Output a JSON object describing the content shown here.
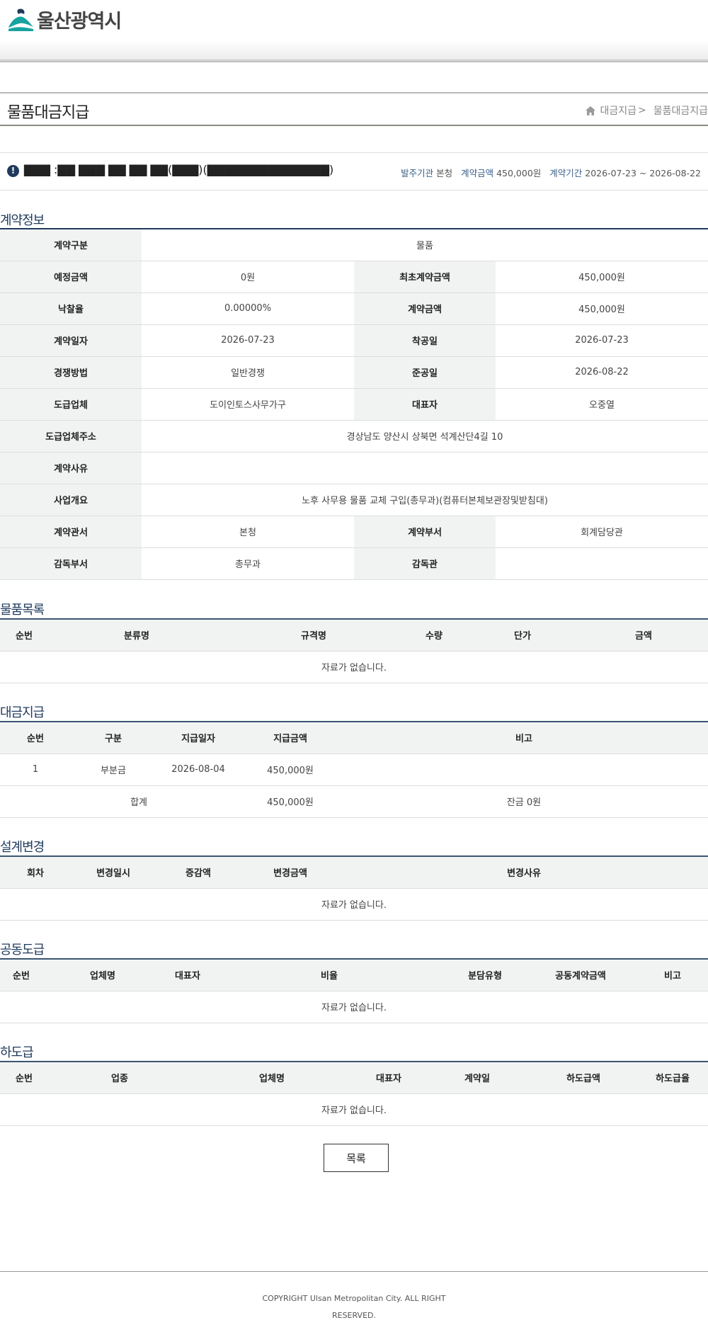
{
  "header": {
    "logo_text": "울산광역시",
    "colors": {
      "logo_teal": "#16a3a0",
      "logo_navy": "#1f3a5c"
    }
  },
  "page": {
    "title": "물품대금지급",
    "breadcrumb": {
      "home_icon": "home-icon",
      "parent": "대금지급",
      "separator": ">",
      "current": "물품대금지급"
    }
  },
  "contract_header": {
    "redacted_name": "▇▇▇ :▇▇ ▇▇▇ ▇▇ ▇▇ ▇▇(▇▇▇)(▇▇▇▇▇▇▇▇▇▇▇▇▇▇)",
    "order_org_label": "발주기관",
    "order_org": "본청",
    "amount_label": "계약금액",
    "amount": "450,000원",
    "period_label": "계약기간",
    "period": "2026-07-23 ~ 2026-08-22"
  },
  "contract_info": {
    "title": "계약정보",
    "rows": [
      {
        "l1": "계약구분",
        "v1": "물품",
        "full": true
      },
      {
        "l1": "예정금액",
        "v1": "0원",
        "l2": "최초계약금액",
        "v2": "450,000원"
      },
      {
        "l1": "낙찰율",
        "v1": "0.00000%",
        "l2": "계약금액",
        "v2": "450,000원"
      },
      {
        "l1": "계약일자",
        "v1": "2026-07-23",
        "l2": "착공일",
        "v2": "2026-07-23"
      },
      {
        "l1": "경쟁방법",
        "v1": "일반경쟁",
        "l2": "준공일",
        "v2": "2026-08-22"
      },
      {
        "l1": "도급업체",
        "v1": "도이인토스사무가구",
        "l2": "대표자",
        "v2": "오중열"
      },
      {
        "l1": "도급업체주소",
        "v1": "경상남도 양산시 상북면 석계산단4길 10",
        "full": true
      },
      {
        "l1": "계약사유",
        "v1": "",
        "full": true
      },
      {
        "l1": "사업개요",
        "v1": "노후 사무용 물품 교체 구입(총무과)(컴퓨터본체보관장및받침대)",
        "full": true
      },
      {
        "l1": "계약관서",
        "v1": "본청",
        "l2": "계약부서",
        "v2": "회계담당관"
      },
      {
        "l1": "감독부서",
        "v1": "총무과",
        "l2": "감독관",
        "v2": ""
      }
    ]
  },
  "goods": {
    "title": "물품목록",
    "headers": [
      "순번",
      "분류명",
      "규격명",
      "수량",
      "단가",
      "금액"
    ],
    "empty": "자료가 없습니다."
  },
  "payment": {
    "title": "대금지급",
    "headers": [
      "순번",
      "구분",
      "지급일자",
      "지급금액",
      "비고"
    ],
    "rows": [
      [
        "1",
        "부분금",
        "2026-08-04",
        "450,000원",
        ""
      ]
    ],
    "total_label": "합계",
    "total_amount": "450,000원",
    "balance": "잔금 0원"
  },
  "design_change": {
    "title": "설계변경",
    "headers": [
      "회차",
      "변경일시",
      "증감액",
      "변경금액",
      "변경사유"
    ],
    "empty": "자료가 없습니다."
  },
  "joint": {
    "title": "공동도급",
    "headers": [
      "순번",
      "업체명",
      "대표자",
      "비율",
      "분담유형",
      "공동계약금액",
      "비고"
    ],
    "empty": "자료가 없습니다."
  },
  "subcontract": {
    "title": "하도급",
    "headers": [
      "순번",
      "업종",
      "업체명",
      "대표자",
      "계약일",
      "하도급액",
      "하도급율"
    ],
    "empty": "자료가 없습니다."
  },
  "buttons": {
    "list": "목록"
  },
  "footer": {
    "line1": "COPYRIGHT     Ulsan Metropolitan City. ALL RIGHT",
    "line2": "RESERVED."
  }
}
